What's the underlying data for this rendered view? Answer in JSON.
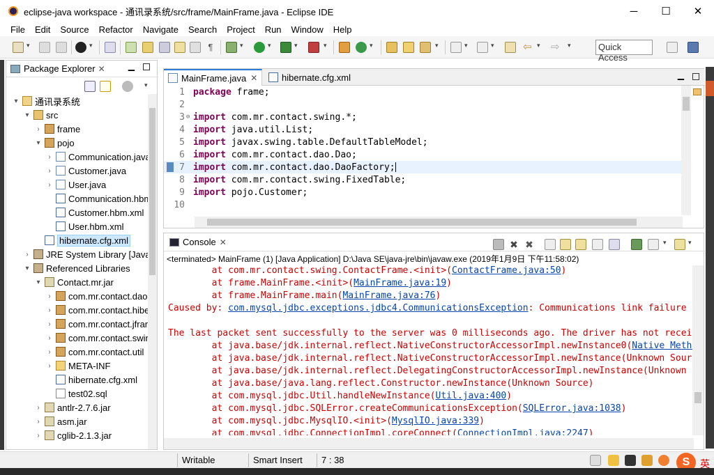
{
  "window": {
    "title": "eclipse-java workspace - 通讯录系统/src/frame/MainFrame.java - Eclipse IDE",
    "minimize": "─",
    "maximize": "☐",
    "close": "✕"
  },
  "menu": [
    "File",
    "Edit",
    "Source",
    "Refactor",
    "Navigate",
    "Search",
    "Project",
    "Run",
    "Window",
    "Help"
  ],
  "toolbar": {
    "quick_access": "Quick Access"
  },
  "package_explorer": {
    "title": "Package Explorer",
    "close": "✕",
    "items": [
      {
        "label": "通讯录系统",
        "icon": "project-icon",
        "twisty": "▾",
        "indent": 0
      },
      {
        "label": "src",
        "icon": "source-folder-icon",
        "twisty": "▾",
        "indent": 1
      },
      {
        "label": "frame",
        "icon": "package-icon",
        "twisty": "›",
        "indent": 2
      },
      {
        "label": "pojo",
        "icon": "package-icon",
        "twisty": "▾",
        "indent": 2
      },
      {
        "label": "Communication.java",
        "icon": "java-file-icon",
        "twisty": "›",
        "indent": 3
      },
      {
        "label": "Customer.java",
        "icon": "java-file-icon",
        "twisty": "›",
        "indent": 3
      },
      {
        "label": "User.java",
        "icon": "java-file-icon",
        "twisty": "›",
        "indent": 3
      },
      {
        "label": "Communication.hbm.xml",
        "icon": "xml-file-icon",
        "twisty": "",
        "indent": 3
      },
      {
        "label": "Customer.hbm.xml",
        "icon": "xml-file-icon",
        "twisty": "",
        "indent": 3
      },
      {
        "label": "User.hbm.xml",
        "icon": "xml-file-icon",
        "twisty": "",
        "indent": 3
      },
      {
        "label": "hibernate.cfg.xml",
        "icon": "xml-file-icon",
        "twisty": "",
        "indent": 2,
        "selected": true
      },
      {
        "label": "JRE System Library [JavaSE]",
        "icon": "library-icon",
        "twisty": "›",
        "indent": 1
      },
      {
        "label": "Referenced Libraries",
        "icon": "library-icon",
        "twisty": "▾",
        "indent": 1
      },
      {
        "label": "Contact.mr.jar",
        "icon": "jar-icon",
        "twisty": "▾",
        "indent": 2
      },
      {
        "label": "com.mr.contact.dao",
        "icon": "package-icon",
        "twisty": "›",
        "indent": 3
      },
      {
        "label": "com.mr.contact.hibernate",
        "icon": "package-icon",
        "twisty": "›",
        "indent": 3
      },
      {
        "label": "com.mr.contact.jframe",
        "icon": "package-icon",
        "twisty": "›",
        "indent": 3
      },
      {
        "label": "com.mr.contact.swing",
        "icon": "package-icon",
        "twisty": "›",
        "indent": 3
      },
      {
        "label": "com.mr.contact.util",
        "icon": "package-icon",
        "twisty": "›",
        "indent": 3
      },
      {
        "label": "META-INF",
        "icon": "folder-icon",
        "twisty": "›",
        "indent": 3
      },
      {
        "label": "hibernate.cfg.xml",
        "icon": "xml-file-icon",
        "twisty": "",
        "indent": 3
      },
      {
        "label": "test02.sql",
        "icon": "sql-file-icon",
        "twisty": "",
        "indent": 3
      },
      {
        "label": "antlr-2.7.6.jar",
        "icon": "jar-icon",
        "twisty": "›",
        "indent": 2
      },
      {
        "label": "asm.jar",
        "icon": "jar-icon",
        "twisty": "›",
        "indent": 2
      },
      {
        "label": "cglib-2.1.3.jar",
        "icon": "jar-icon",
        "twisty": "›",
        "indent": 2
      }
    ]
  },
  "editor": {
    "tabs": [
      {
        "label": "MainFrame.java",
        "close": "✕",
        "active": true
      },
      {
        "label": "hibernate.cfg.xml",
        "active": false
      }
    ],
    "lines": [
      {
        "n": "1",
        "kw": "package",
        "rest": " frame;"
      },
      {
        "n": "2",
        "kw": "",
        "rest": ""
      },
      {
        "n": "3",
        "kw": "import",
        "rest": " com.mr.contact.swing.*;",
        "fold": "⊖"
      },
      {
        "n": "4",
        "kw": "import",
        "rest": " java.util.List;"
      },
      {
        "n": "5",
        "kw": "import",
        "rest": " javax.swing.table.DefaultTableModel;"
      },
      {
        "n": "6",
        "kw": "import",
        "rest": " com.mr.contact.dao.Dao;"
      },
      {
        "n": "7",
        "kw": "import",
        "rest": " com.mr.contact.dao.DaoFactory;",
        "current": true
      },
      {
        "n": "8",
        "kw": "import",
        "rest": " com.mr.contact.swing.FixedTable;"
      },
      {
        "n": "9",
        "kw": "import",
        "rest": " pojo.Customer;"
      },
      {
        "n": "10",
        "kw": "",
        "rest": ""
      }
    ]
  },
  "console": {
    "title": "Console",
    "close": "✕",
    "header": "<terminated> MainFrame (1) [Java Application] D:\\Java SE\\java-jre\\bin\\javaw.exe (2019年1月9日 下午11:58:02)",
    "lines": [
      {
        "pre": "        at com.mr.contact.swing.ContactFrame.<init>(",
        "link": "ContactFrame.java:50",
        "post": ")"
      },
      {
        "pre": "        at frame.MainFrame.<init>(",
        "link": "MainFrame.java:19",
        "post": ")"
      },
      {
        "pre": "        at frame.MainFrame.main(",
        "link": "MainFrame.java:76",
        "post": ")"
      },
      {
        "pre": "Caused by: ",
        "link": "com.mysql.jdbc.exceptions.jdbc4.CommunicationsException",
        "post": ": Communications link failure"
      },
      {
        "pre": "",
        "link": "",
        "post": ""
      },
      {
        "pre": "The last packet sent successfully to the server was 0 milliseconds ago. The driver has not received any packets from the server.",
        "link": "",
        "post": ""
      },
      {
        "pre": "        at java.base/jdk.internal.reflect.NativeConstructorAccessorImpl.newInstance0(",
        "link": "Native Method",
        "post": ")"
      },
      {
        "pre": "        at java.base/jdk.internal.reflect.NativeConstructorAccessorImpl.newInstance(Unknown Source)",
        "link": "",
        "post": ""
      },
      {
        "pre": "        at java.base/jdk.internal.reflect.DelegatingConstructorAccessorImpl.newInstance(Unknown Source)",
        "link": "",
        "post": ""
      },
      {
        "pre": "        at java.base/java.lang.reflect.Constructor.newInstance(Unknown Source)",
        "link": "",
        "post": ""
      },
      {
        "pre": "        at com.mysql.jdbc.Util.handleNewInstance(",
        "link": "Util.java:400",
        "post": ")"
      },
      {
        "pre": "        at com.mysql.jdbc.SQLError.createCommunicationsException(",
        "link": "SQLError.java:1038",
        "post": ")"
      },
      {
        "pre": "        at com.mysql.jdbc.MysqlIO.<init>(",
        "link": "MysqlIO.java:339",
        "post": ")"
      },
      {
        "pre": "        at com.mysql.jdbc.ConnectionImpl.coreConnect(",
        "link": "ConnectionImpl.java:2247",
        "post": ")"
      }
    ]
  },
  "status": {
    "writable": "Writable",
    "insert_mode": "Smart Insert",
    "position": "7 : 38",
    "ime_logo": "S",
    "ime_lang": "英"
  }
}
